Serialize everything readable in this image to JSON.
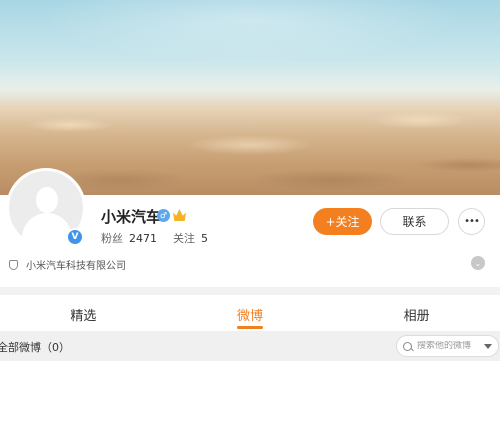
{
  "profile": {
    "name": "小米汽车",
    "verified_icon": "blue-verified-badge",
    "gender_icon": "male-icon",
    "vip_icon": "crown-icon",
    "stats": [
      {
        "label": "粉丝",
        "value": "2471"
      },
      {
        "label": "关注",
        "value": "5"
      }
    ],
    "company": "小米汽车科技有限公司"
  },
  "actions": {
    "follow_label": "+关注",
    "contact_label": "联系",
    "more_label": "•••"
  },
  "tabs": [
    {
      "label": "精选",
      "active": false
    },
    {
      "label": "微博",
      "active": true
    },
    {
      "label": "相册",
      "active": false
    }
  ],
  "feed": {
    "all_posts_label": "全部微博（0）",
    "search_placeholder": "搜索他的微博"
  },
  "colors": {
    "accent": "#f47f1f",
    "verified_blue": "#3f96e8"
  }
}
